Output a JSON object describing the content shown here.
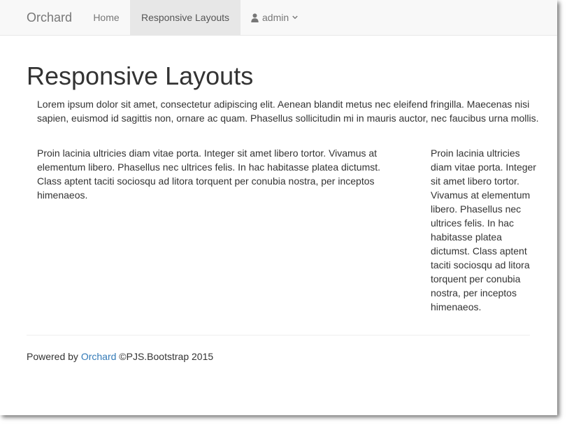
{
  "navbar": {
    "brand": "Orchard",
    "items": [
      {
        "label": "Home"
      },
      {
        "label": "Responsive Layouts",
        "active": true
      }
    ],
    "user": {
      "label": "admin",
      "icon": "user-icon",
      "caret": "chevron-down-icon"
    }
  },
  "page": {
    "title": "Responsive Layouts",
    "intro": "Lorem ipsum dolor sit amet, consectetur adipiscing elit. Aenean blandit metus nec eleifend fringilla. Maecenas nisi sapien, euismod id sagittis non, ornare ac quam. Phasellus sollicitudin mi in mauris auctor, nec faucibus urna mollis.",
    "main_column": "Proin lacinia ultricies diam vitae porta. Integer sit amet libero tortor. Vivamus at elementum libero. Phasellus nec ultrices felis. In hac habitasse platea dictumst. Class aptent taciti sociosqu ad litora torquent per conubia nostra, per inceptos himenaeos.",
    "side_column": "Proin lacinia ultricies diam vitae porta. Integer sit amet libero tortor. Vivamus at elementum libero. Phasellus nec ultrices felis. In hac habitasse platea dictumst. Class aptent taciti sociosqu ad litora torquent per conubia nostra, per inceptos himenaeos."
  },
  "footer": {
    "prefix": "Powered by",
    "link": "Orchard",
    "suffix": "©PJS.Bootstrap 2015"
  },
  "colors": {
    "navbar_bg": "#f8f8f8",
    "active_bg": "#e7e7e7",
    "link": "#337ab7",
    "text": "#333333",
    "nav_text": "#777777"
  }
}
